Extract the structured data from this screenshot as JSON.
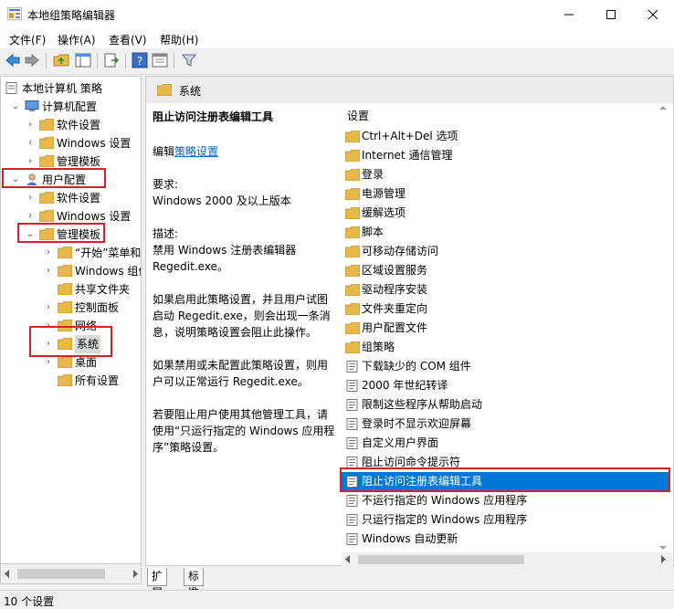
{
  "window": {
    "title": "本地组策略编辑器"
  },
  "menu": [
    "文件(F)",
    "操作(A)",
    "查看(V)",
    "帮助(H)"
  ],
  "tree": [
    {
      "label": "本地计算机 策略",
      "arrow": "",
      "icon": "policy-icon",
      "level": 0
    },
    {
      "label": "计算机配置",
      "arrow": "down",
      "icon": "computer-icon",
      "level": 1
    },
    {
      "label": "软件设置",
      "arrow": "right",
      "icon": "folder-icon",
      "level": 2
    },
    {
      "label": "Windows 设置",
      "arrow": "right",
      "icon": "folder-icon",
      "level": 2
    },
    {
      "label": "管理模板",
      "arrow": "right",
      "icon": "folder-icon",
      "level": 2
    },
    {
      "label": "用户配置",
      "arrow": "down",
      "icon": "user-icon",
      "level": 1
    },
    {
      "label": "软件设置",
      "arrow": "right",
      "icon": "folder-icon",
      "level": 2
    },
    {
      "label": "Windows 设置",
      "arrow": "right",
      "icon": "folder-icon",
      "level": 2
    },
    {
      "label": "管理模板",
      "arrow": "down",
      "icon": "folder-icon",
      "level": 2
    },
    {
      "label": "“开始”菜单和",
      "arrow": "right",
      "icon": "folder-icon",
      "level": 3
    },
    {
      "label": "Windows 组件",
      "arrow": "right",
      "icon": "folder-icon",
      "level": 3
    },
    {
      "label": "共享文件夹",
      "arrow": "",
      "icon": "folder-icon",
      "level": 3
    },
    {
      "label": "控制面板",
      "arrow": "right",
      "icon": "folder-icon",
      "level": 3
    },
    {
      "label": "网络",
      "arrow": "right",
      "icon": "folder-icon",
      "level": 3
    },
    {
      "label": "系统",
      "arrow": "right",
      "icon": "folder-icon",
      "level": 3,
      "selected": true
    },
    {
      "label": "桌面",
      "arrow": "right",
      "icon": "folder-icon",
      "level": 3
    },
    {
      "label": "所有设置",
      "arrow": "",
      "icon": "settings-folder-icon",
      "level": 3
    }
  ],
  "right_header": "系统",
  "description": {
    "title": "阻止访问注册表编辑工具",
    "edit_prefix": "编辑",
    "edit_link": "策略设置",
    "requirements_label": "要求:",
    "requirements": "Windows 2000 及以上版本",
    "desc_label": "描述:",
    "desc_lines": [
      "禁用 Windows 注册表编辑器",
      "Regedit.exe。"
    ],
    "para1": [
      "如果启用此策略设置，并且用户试图",
      "启动 Regedit.exe，则会出现一条消",
      "息，说明策略设置会阻止此操作。"
    ],
    "para2": [
      "如果禁用或未配置此策略设置，则用",
      "户可以正常运行 Regedit.exe。"
    ],
    "para3": [
      "若要阻止用户使用其他管理工具，请",
      "使用“只运行指定的 Windows 应用程",
      "序”策略设置。"
    ]
  },
  "list_header": "设置",
  "settings": [
    {
      "label": "Ctrl+Alt+Del 选项",
      "type": "folder"
    },
    {
      "label": "Internet 通信管理",
      "type": "folder"
    },
    {
      "label": "登录",
      "type": "folder"
    },
    {
      "label": "电源管理",
      "type": "folder"
    },
    {
      "label": "缓解选项",
      "type": "folder"
    },
    {
      "label": "脚本",
      "type": "folder"
    },
    {
      "label": "可移动存储访问",
      "type": "folder"
    },
    {
      "label": "区域设置服务",
      "type": "folder"
    },
    {
      "label": "驱动程序安装",
      "type": "folder"
    },
    {
      "label": "文件夹重定向",
      "type": "folder"
    },
    {
      "label": "用户配置文件",
      "type": "folder"
    },
    {
      "label": "组策略",
      "type": "folder"
    },
    {
      "label": "下载缺少的 COM 组件",
      "type": "policy"
    },
    {
      "label": "2000 年世纪转译",
      "type": "policy"
    },
    {
      "label": "限制这些程序从帮助启动",
      "type": "policy"
    },
    {
      "label": "登录时不显示欢迎屏幕",
      "type": "policy"
    },
    {
      "label": "自定义用户界面",
      "type": "policy"
    },
    {
      "label": "阻止访问命令提示符",
      "type": "policy"
    },
    {
      "label": "阻止访问注册表编辑工具",
      "type": "policy",
      "selected": true
    },
    {
      "label": "不运行指定的 Windows 应用程序",
      "type": "policy"
    },
    {
      "label": "只运行指定的 Windows 应用程序",
      "type": "policy"
    },
    {
      "label": "Windows 自动更新",
      "type": "policy"
    }
  ],
  "tabs": [
    "扩展",
    "标准"
  ],
  "status": "10 个设置",
  "colors": {
    "selection": "#0078d7",
    "highlight_box": "#d6202a",
    "folder": "#e8b84a",
    "link": "#0066cc"
  }
}
